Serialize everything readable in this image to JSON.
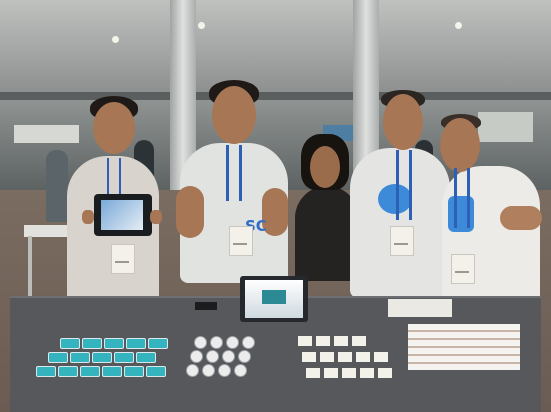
{
  "scene": {
    "shirt_text": "SC",
    "colors": {
      "lanyard": "#2d5fb5",
      "shirt_accent": "#3d8bd8",
      "sticker": "#34b4bf",
      "tablecloth": "#56585b",
      "carpet": "#6a5c53"
    }
  }
}
